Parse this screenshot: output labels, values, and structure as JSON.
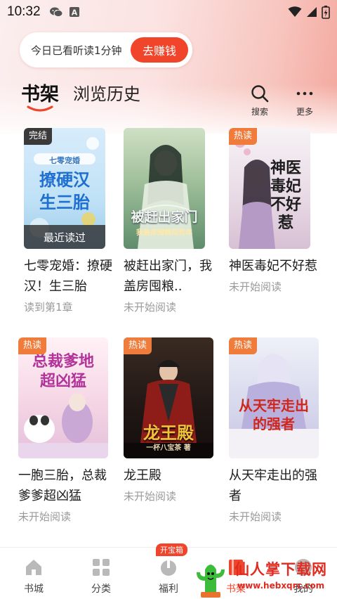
{
  "status_bar": {
    "time": "10:32"
  },
  "reward": {
    "text": "今日已看听读1分钟",
    "button": "去赚钱"
  },
  "tabs": {
    "active": "书架",
    "inactive": "浏览历史"
  },
  "actions": {
    "search": "搜索",
    "more": "更多"
  },
  "books": [
    {
      "title": "七零宠婚：撩硬汉！生三胎",
      "progress": "读到第1章",
      "tag": "完结",
      "ribbon": "最近读过",
      "cover_text": "撩硬汉 生三胎",
      "cover_sub": "七零宠婚"
    },
    {
      "title": "被赶出家门，我盖房囤粮..",
      "progress": "未开始阅读",
      "tag": "",
      "cover_text": "被赶出家门",
      "cover_sub": "我盖房囤粮闯荒年"
    },
    {
      "title": "神医毒妃不好惹",
      "progress": "未开始阅读",
      "tag": "热读",
      "cover_text": "神医毒妃 不好惹"
    },
    {
      "title": "一胞三胎，总裁爹爹超凶猛",
      "progress": "未开始阅读",
      "tag": "热读",
      "cover_text": "总裁爹地 超凶猛"
    },
    {
      "title": "龙王殿",
      "progress": "未开始阅读",
      "tag": "热读",
      "cover_text": "龙王殿",
      "cover_sub": "一杯八宝茶 著"
    },
    {
      "title": "从天牢走出的强者",
      "progress": "未开始阅读",
      "tag": "热读",
      "cover_text": "从天牢走出 的强者"
    }
  ],
  "nav": {
    "items": [
      {
        "label": "书城"
      },
      {
        "label": "分类"
      },
      {
        "label": "福利",
        "badge": "开宝箱"
      },
      {
        "label": "书架"
      },
      {
        "label": "我的"
      }
    ]
  },
  "watermark": {
    "title": "仙人掌下载网",
    "url": "www.hebxqrc.com"
  },
  "colors": {
    "accent": "#f0442b",
    "tag_hot": "#f07c3c",
    "tag_done": "#3a3a3a"
  }
}
